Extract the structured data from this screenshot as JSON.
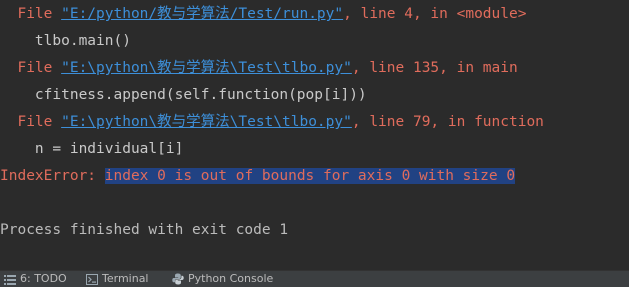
{
  "traceback": [
    {
      "file_prefix": "  File ",
      "path": "\"E:/python/教与学算法/Test/run.py\"",
      "suffix": ", line 4, in <module>",
      "code": "    tlbo.main()"
    },
    {
      "file_prefix": "  File ",
      "path": "\"E:\\python\\教与学算法\\Test\\tlbo.py\"",
      "suffix": ", line 135, in main",
      "code": "    cfitness.append(self.function(pop[i]))"
    },
    {
      "file_prefix": "  File ",
      "path": "\"E:\\python\\教与学算法\\Test\\tlbo.py\"",
      "suffix": ", line 79, in function",
      "code": "    n = individual[i]"
    }
  ],
  "exception": {
    "name": "IndexError: ",
    "message": "index 0 is out of bounds for axis 0 with size 0"
  },
  "process_exit": "Process finished with exit code 1",
  "bottom_bar": {
    "todo_label": "6: TODO",
    "terminal_label": "Terminal",
    "python_console_label": "Python Console"
  },
  "colors": {
    "background": "#2b2b2b",
    "error_text": "#e06c5c",
    "link": "#3d8fd9",
    "selection": "#214283"
  }
}
